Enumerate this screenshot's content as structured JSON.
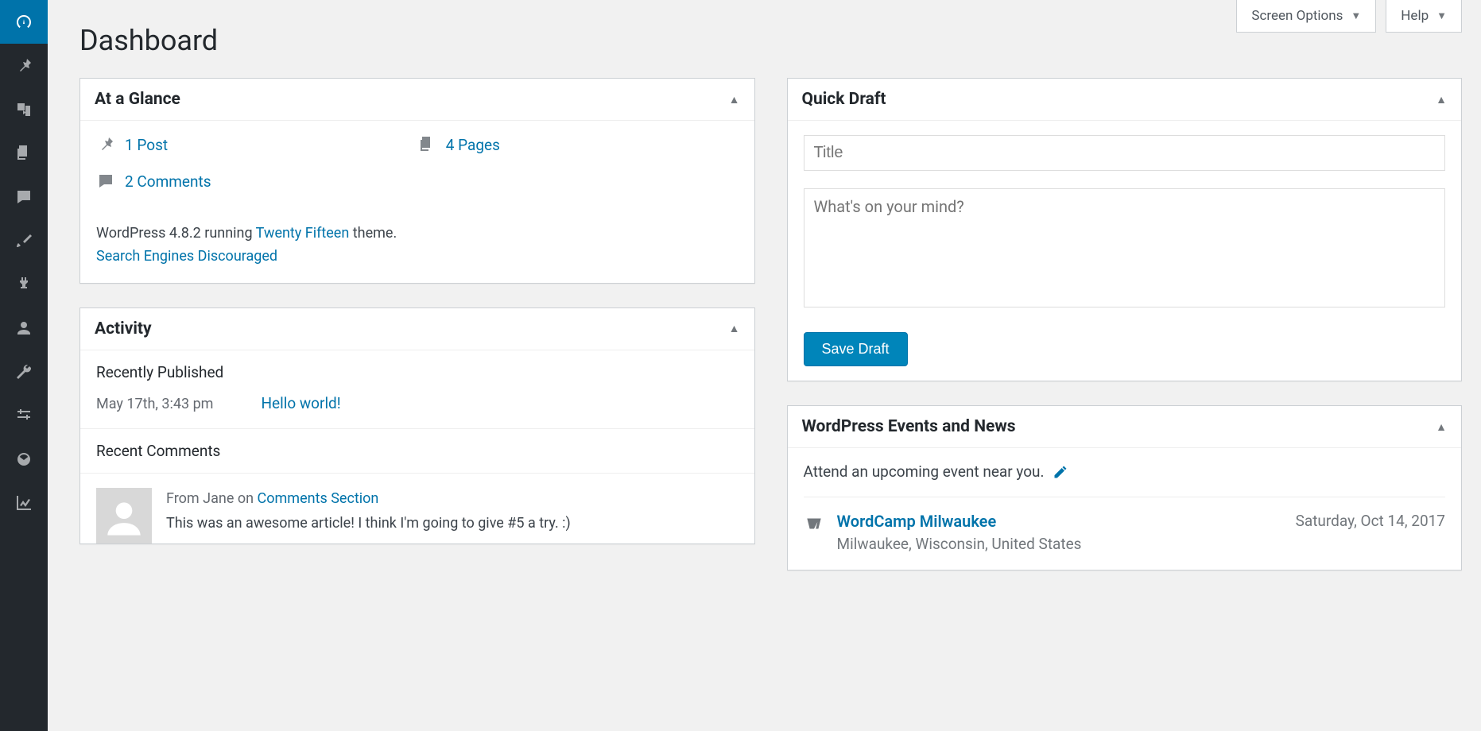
{
  "page": {
    "title": "Dashboard"
  },
  "topControls": {
    "screenOptions": "Screen Options",
    "help": "Help"
  },
  "glance": {
    "title": "At a Glance",
    "posts": "1 Post",
    "pages": "4 Pages",
    "comments": "2 Comments",
    "versionPrefix": "WordPress 4.8.2 running ",
    "themeLink": "Twenty Fifteen",
    "versionSuffix": " theme.",
    "searchEngines": "Search Engines Discouraged"
  },
  "activity": {
    "title": "Activity",
    "recentlyPublished": "Recently Published",
    "published": {
      "date": "May 17th, 3:43 pm",
      "title": "Hello world!"
    },
    "recentComments": "Recent Comments",
    "comment": {
      "fromPrefix": "From ",
      "author": "Jane",
      "on": " on ",
      "post": "Comments Section",
      "body": "This was an awesome article! I think I'm going to give #5 a try. :)"
    }
  },
  "quickDraft": {
    "title": "Quick Draft",
    "titlePlaceholder": "Title",
    "contentPlaceholder": "What's on your mind?",
    "saveLabel": "Save Draft"
  },
  "events": {
    "title": "WordPress Events and News",
    "intro": "Attend an upcoming event near you.",
    "item": {
      "name": "WordCamp Milwaukee",
      "location": "Milwaukee, Wisconsin, United States",
      "date": "Saturday, Oct 14, 2017"
    }
  }
}
